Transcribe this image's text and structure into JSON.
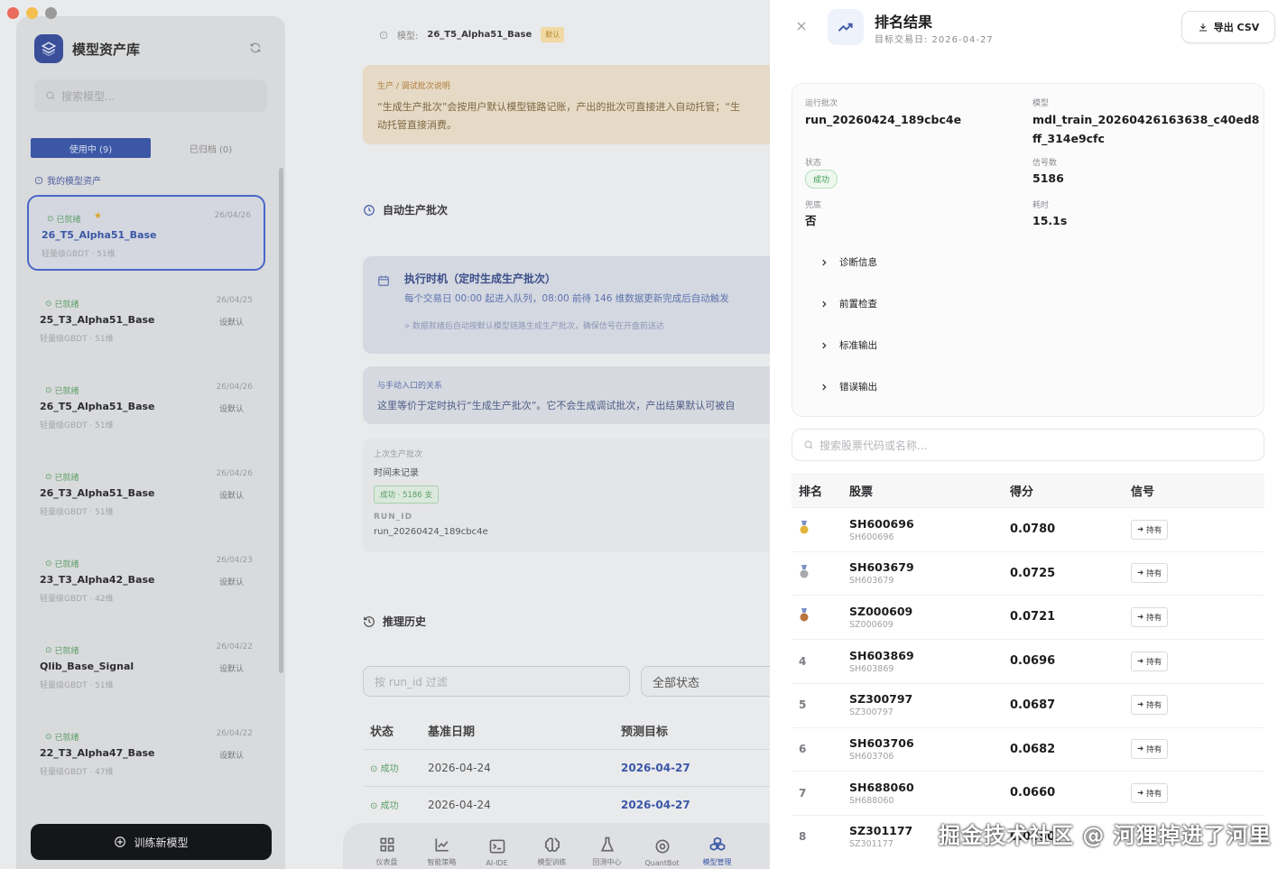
{
  "sidebar": {
    "title": "模型资产库",
    "search_placeholder": "搜索模型...",
    "tabs": [
      {
        "label": "使用中 (9)"
      },
      {
        "label": "已归档 (0)"
      }
    ],
    "section_label": "我的模型资产",
    "models": [
      {
        "status": "已就绪",
        "date": "26/04/26",
        "name": "26_T5_Alpha51_Base",
        "meta": "轻量级GBDT · 51维",
        "default": "",
        "starred": true,
        "selected": true
      },
      {
        "status": "已就绪",
        "date": "26/04/25",
        "name": "25_T3_Alpha51_Base",
        "meta": "轻量级GBDT · 51维",
        "default": "设默认",
        "starred": false,
        "selected": false
      },
      {
        "status": "已就绪",
        "date": "26/04/26",
        "name": "26_T5_Alpha51_Base",
        "meta": "轻量级GBDT · 51维",
        "default": "设默认",
        "starred": false,
        "selected": false
      },
      {
        "status": "已就绪",
        "date": "26/04/26",
        "name": "26_T3_Alpha51_Base",
        "meta": "轻量级GBDT · 51维",
        "default": "设默认",
        "starred": false,
        "selected": false
      },
      {
        "status": "已就绪",
        "date": "26/04/23",
        "name": "23_T3_Alpha42_Base",
        "meta": "轻量级GBDT · 42维",
        "default": "设默认",
        "starred": false,
        "selected": false
      },
      {
        "status": "已就绪",
        "date": "26/04/22",
        "name": "Qlib_Base_Signal",
        "meta": "轻量级GBDT · 51维",
        "default": "设默认",
        "starred": false,
        "selected": false
      },
      {
        "status": "已就绪",
        "date": "26/04/22",
        "name": "22_T3_Alpha47_Base",
        "meta": "轻量级GBDT · 47维",
        "default": "设默认",
        "starred": false,
        "selected": false
      }
    ],
    "train_button": "训练新模型"
  },
  "main": {
    "model_label": "模型:",
    "model_name": "26_T5_Alpha51_Base",
    "model_badge": "默认",
    "notice_title": "生产 / 调试批次说明",
    "notice_line1": "“生成生产批次”会按用户默认模型链路记账，产出的批次可直接进入自动托管；“生",
    "notice_line2": "动托管直接消费。",
    "auto_section": "自动生产批次",
    "sched_title": "执行时机（定时生成生产批次）",
    "sched_text": "每个交易日 00:00 起进入队列，08:00 前待 146 维数据更新完成后自动触发",
    "sched_sub": "数据就绪后自动按默认模型链路生成生产批次，确保信号在开盘前送达",
    "relation_title": "与手动入口的关系",
    "relation_text": "这里等价于定时执行“生成生产批次”。它不会生成调试批次，产出结果默认可被自",
    "last_label": "上次生产批次",
    "last_value": "时间未记录",
    "last_badge": "成功 · 5186 支",
    "run_id_label": "RUN_ID",
    "run_id_value": "run_20260424_189cbc4e",
    "history_section": "推理历史",
    "filter_placeholder": "按 run_id 过滤",
    "filter_status": "全部状态",
    "history_headers": [
      "状态",
      "基准日期",
      "预测目标"
    ],
    "history_rows": [
      {
        "status": "成功",
        "date": "2026-04-24",
        "target": "2026-04-27"
      },
      {
        "status": "成功",
        "date": "2026-04-24",
        "target": "2026-04-27"
      }
    ]
  },
  "nav": [
    {
      "label": "仪表盘",
      "icon": "dashboard-icon"
    },
    {
      "label": "智能策略",
      "icon": "chart-icon"
    },
    {
      "label": "AI-IDE",
      "icon": "terminal-icon"
    },
    {
      "label": "模型训练",
      "icon": "brain-icon"
    },
    {
      "label": "回测中心",
      "icon": "flask-icon"
    },
    {
      "label": "QuantBot",
      "icon": "bot-icon"
    },
    {
      "label": "模型管理",
      "icon": "cubes-icon"
    }
  ],
  "drawer": {
    "title": "排名结果",
    "subtitle": "目标交易日: 2026-04-27",
    "export_label": "导出 CSV",
    "run_batch_label": "运行批次",
    "run_batch_value": "run_20260424_189cbc4e",
    "model_label": "模型",
    "model_value_1": "mdl_train_20260426163638_c40ed8",
    "model_value_2": "ff_314e9cfc",
    "status_label": "状态",
    "status_value": "成功",
    "signal_count_label": "信号数",
    "signal_count_value": "5186",
    "fallback_label": "兜底",
    "fallback_value": "否",
    "elapsed_label": "耗时",
    "elapsed_value": "15.1s",
    "expanders": [
      "诊断信息",
      "前置检查",
      "标准输出",
      "错误输出"
    ],
    "search_placeholder": "搜索股票代码或名称...",
    "headers": {
      "rank": "排名",
      "stock": "股票",
      "score": "得分",
      "signal": "信号"
    },
    "rows": [
      {
        "rank": "1",
        "code": "SH600696",
        "name": "SH600696",
        "score": "0.0780",
        "signal": "持有"
      },
      {
        "rank": "2",
        "code": "SH603679",
        "name": "SH603679",
        "score": "0.0725",
        "signal": "持有"
      },
      {
        "rank": "3",
        "code": "SZ000609",
        "name": "SZ000609",
        "score": "0.0721",
        "signal": "持有"
      },
      {
        "rank": "4",
        "code": "SH603869",
        "name": "SH603869",
        "score": "0.0696",
        "signal": "持有"
      },
      {
        "rank": "5",
        "code": "SZ300797",
        "name": "SZ300797",
        "score": "0.0687",
        "signal": "持有"
      },
      {
        "rank": "6",
        "code": "SH603706",
        "name": "SH603706",
        "score": "0.0682",
        "signal": "持有"
      },
      {
        "rank": "7",
        "code": "SH688060",
        "name": "SH688060",
        "score": "0.0660",
        "signal": "持有"
      },
      {
        "rank": "8",
        "code": "SZ301177",
        "name": "SZ301177",
        "score": "0.0650",
        "signal": ""
      }
    ]
  },
  "watermark": "掘金技术社区 @ 河狸掉进了河里",
  "colors": {
    "accent": "#3b57a6",
    "success": "#3d9a50",
    "gold": "#d8a52a"
  }
}
